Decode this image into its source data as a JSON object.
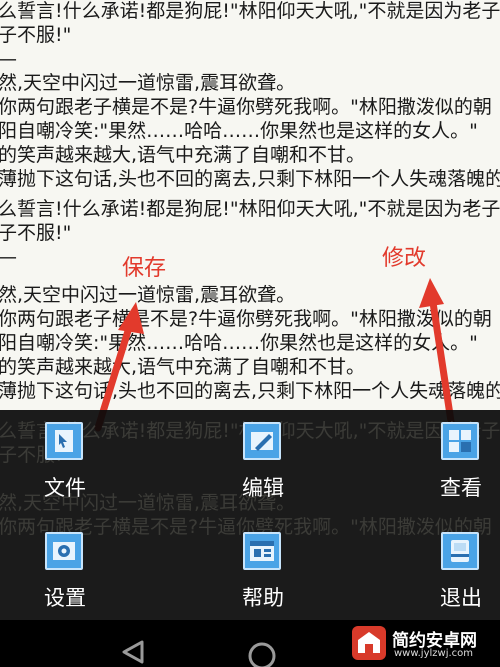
{
  "reader": {
    "lines": [
      "么誓言!什么承诺!都是狗屁!\"林阳仰天大吼,\"不就是因为老子",
      "子不服!\"",
      "—",
      "然,天空中闪过一道惊雷,震耳欲聋。",
      "你两句跟老子横是不是?牛逼你劈死我啊。\"林阳撒泼似的朝",
      "阳自嘲冷笑:\"果然……哈哈……你果然也是这样的女人。\"",
      "的笑声越来越大,语气中充满了自嘲和不甘。",
      "薄抛下这句话,头也不回的离去,只剩下林阳一个人失魂落魄的",
      "么誓言!什么承诺!都是狗屁!\"林阳仰天大吼,\"不就是因为老子",
      "子不服!\"",
      "—",
      "然,天空中闪过一道惊雷,震耳欲聋。",
      "你两句跟老子横是不是?牛逼你劈死我啊。\"林阳撒泼似的朝",
      "阳自嘲冷笑:\"果然……哈哈……你果然也是这样的女人。\"",
      "的笑声越来越大,语气中充满了自嘲和不甘。",
      "薄抛下这句话,头也不回的离去,只剩下林阳一个人失魂落魄的"
    ],
    "faded_lines": [
      "么誓言!什么承诺!都是狗屁!\"林阳仰天大吼,\"不就是因为老子",
      "子不服!\"",
      "然,天空中闪过一道惊雷,震耳欲聋。",
      "你两句跟老子横是不是?牛逼你劈死我啊。\"林阳撒泼似的朝"
    ]
  },
  "annotations": {
    "save": "保存",
    "modify": "修改"
  },
  "menu": {
    "items": [
      {
        "label": "文件",
        "icon": "file-icon"
      },
      {
        "label": "编辑",
        "icon": "edit-icon"
      },
      {
        "label": "查看",
        "icon": "view-icon"
      },
      {
        "label": "设置",
        "icon": "settings-icon"
      },
      {
        "label": "帮助",
        "icon": "help-icon"
      },
      {
        "label": "退出",
        "icon": "exit-icon"
      }
    ]
  },
  "watermark": {
    "title": "简约安卓网",
    "url": "www.jylzwj.com"
  },
  "colors": {
    "annotation": "#e23a2c",
    "menu_bg": "#0a0a0a",
    "icon_blue": "#4aa3e6"
  }
}
